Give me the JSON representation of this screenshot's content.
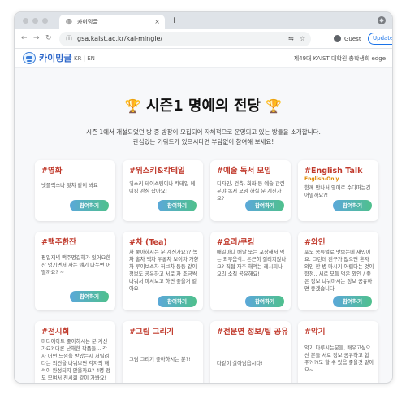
{
  "browser": {
    "tab_title": "카이밍글",
    "tab_icon": "globe-icon",
    "close_glyph": "×",
    "newtab_glyph": "+",
    "url": "gsa.kaist.ac.kr/kai-mingle/",
    "back_glyph": "←",
    "forward_glyph": "→",
    "reload_glyph": "↻",
    "info_glyph": "ⓘ",
    "translate_glyph": "⇋",
    "star_glyph": "☆",
    "guest_label": "Guest",
    "update_label": "Update",
    "menu_glyph": "⋮"
  },
  "site": {
    "logo_text": "카이밍글",
    "lang": "KR | EN",
    "org": "제49대 KAIST 대학원 총학생회 edge"
  },
  "hero": {
    "trophy_left": "🏆",
    "title": "시즌1 명예의 전당",
    "trophy_right": "🏆",
    "intro_line1": "시즌 1에서 개설되었던 방 중 방장이 모집되어 자체적으로 운영되고 있는 방들을 소개합니다.",
    "intro_line2": "관심있는 키워드가 있으시다면 부담없이 참여해 보세요!"
  },
  "join_label": "참여하기",
  "cards": [
    {
      "title": "#영화",
      "desc": "넷플릭스나 왓챠 같이 봐요"
    },
    {
      "title": "#위스키&칵테일",
      "desc": "위스키 테이스팅이나 칵테일 메이킹 관심 잡아요!"
    },
    {
      "title": "#예술 독서 모임",
      "desc": "디자인, 건축, 회화 등 예술 관련 분야 독서 모임 하실 분 계신가요?"
    },
    {
      "title": "#English Talk",
      "sub": "English-Only",
      "desc": "함께 만나서 영어로 수다떠는건 어떨까요?!"
    },
    {
      "title": "#맥주한잔",
      "desc": "평일저녁 맥주명길해가 있어요한잔 명기면서 사는 얘기 나누면 어떨까요? ~"
    },
    {
      "title": "#차 (Tea)",
      "desc": "차 좋아하시는 분 계신가요?? 녹차 홍차 백차 우롱차 보이차 가향차 루이보스차 허브차 등등 같이 정보도 공유하고 서로 차 조금씩 나눠서 마셔보고 하면 좋을거 같아요"
    },
    {
      "title": "#요리/쿠킹",
      "desc": "매일마다 배달 또는 포장해서 먹는 외부음식.. 은근히 질리지않나요? 직접 자주 해먹는 레시피나 요리 소칠 공유해요!"
    },
    {
      "title": "#와인",
      "desc": "포도 종류별로 맛보는데 재밌어요. 그런데 친구가 없으면 혼자 와인 한 병 마시기 어렵다는 것이 함정.. 서로 모들 먹은 와인 / 좋은 정보 나눠마시는 정보 공유하면 좋겠습니다"
    },
    {
      "title": "#전시회",
      "desc": "미디어아트 좋아하시는 분 계신가요? 대론 난해한 작품들... 각자 어떤 느낌을 받았는지 서틸려 다는 의견을 나눠보면 각자의 해석이 완성되지 않을까요? 4명 정도 모여서 전시회 같이 가봐요!"
    },
    {
      "title": "#그림 그리기",
      "desc": "그림 그리기 좋아하시는 분?!"
    },
    {
      "title": "#전문연 정보/팁 공유",
      "desc": "다같이 살아남읍시다!"
    },
    {
      "title": "#악기",
      "desc": "악기 다루시는분들, 배우고싶으신 분들 서로 정보 공유하고 합주?(?)도 할 수 있음 좋을것 같아요~"
    }
  ]
}
